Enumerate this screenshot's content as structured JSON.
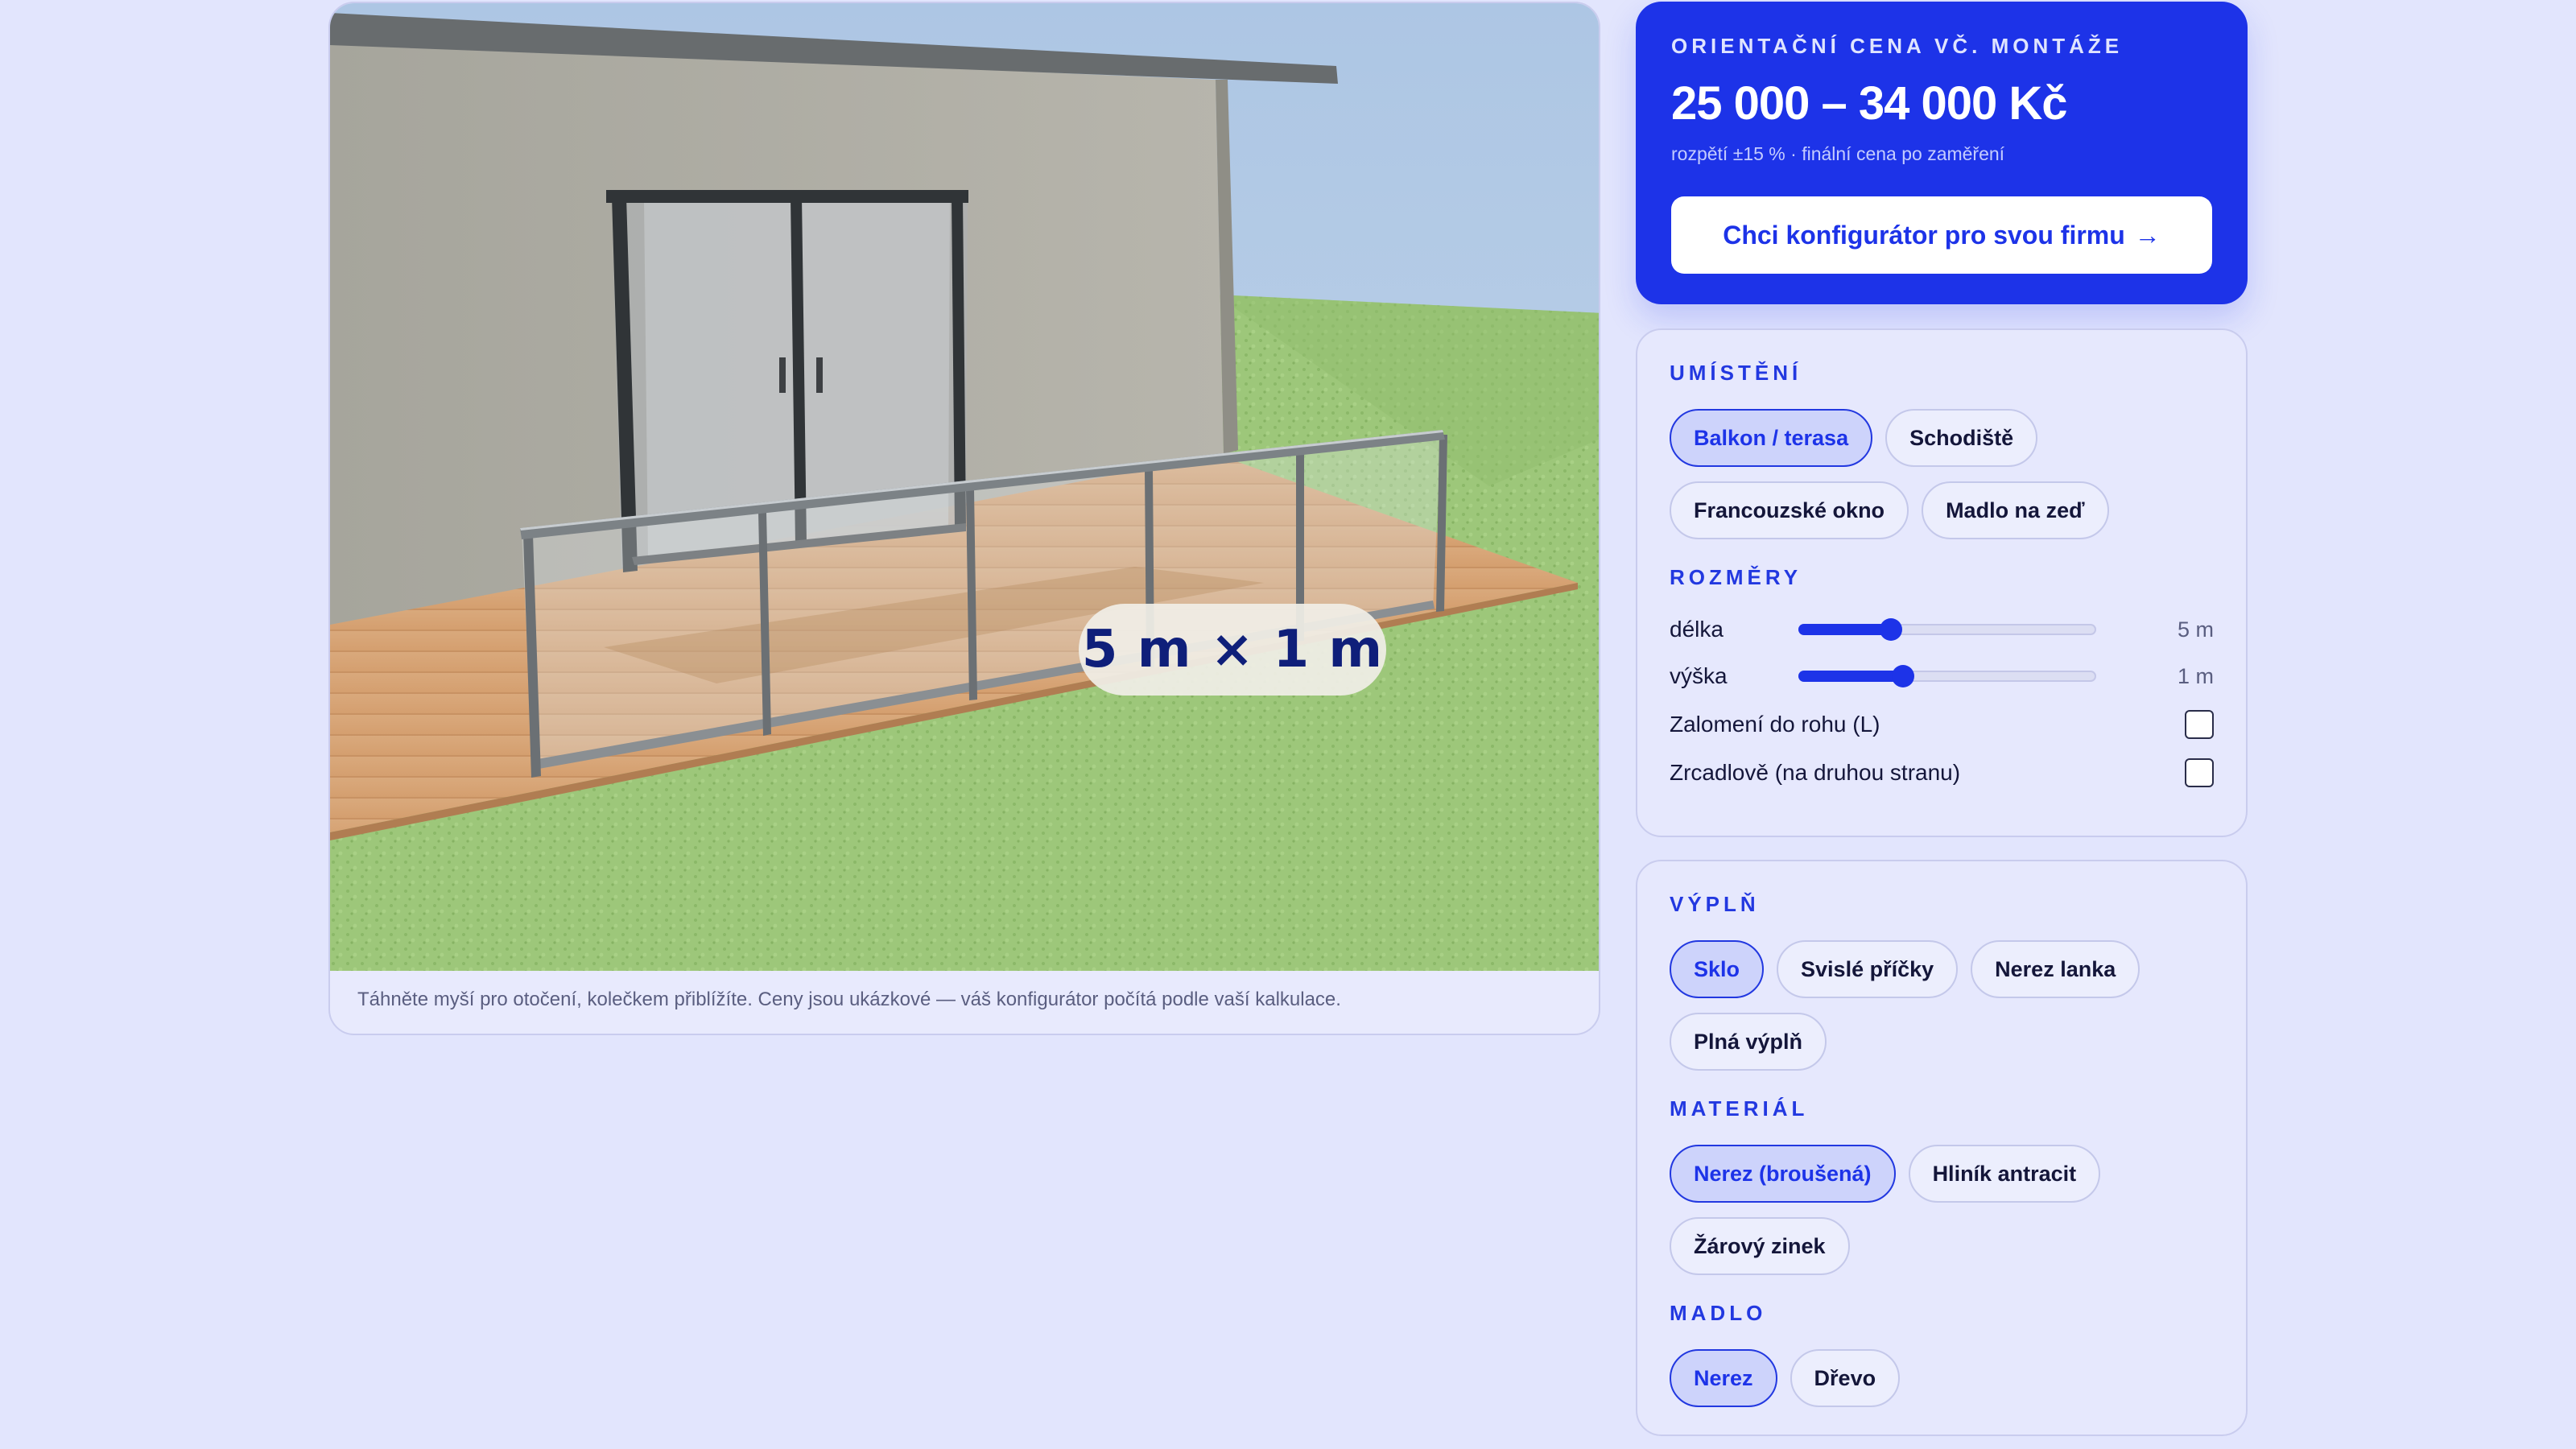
{
  "viewer": {
    "dimension_badge": "5 m × 1 m",
    "caption": "Táhněte myší pro otočení, kolečkem přiblížíte. Ceny jsou ukázkové — váš konfigurátor počítá podle vaší kalkulace."
  },
  "price": {
    "label": "ORIENTAČNÍ CENA VČ. MONTÁŽE",
    "value": "25 000 – 34 000 Kč",
    "note": "rozpětí ±15 % · finální cena po zaměření",
    "cta": "Chci konfigurátor pro svou firmu",
    "cta_arrow": "→",
    "accent_color": "#1d33e8"
  },
  "placement": {
    "title": "UMÍSTĚNÍ",
    "options": [
      "Balkon / terasa",
      "Schodiště",
      "Francouzské okno",
      "Madlo na zeď"
    ],
    "selected": "Balkon / terasa"
  },
  "dimensions": {
    "title": "ROZMĚRY",
    "length": {
      "label": "délka",
      "value": "5 m",
      "fraction": 0.31
    },
    "height": {
      "label": "výška",
      "value": "1 m",
      "fraction": 0.35
    },
    "corner": {
      "label": "Zalomení do rohu (L)",
      "checked": false
    },
    "mirror": {
      "label": "Zrcadlově (na druhou stranu)",
      "checked": false
    }
  },
  "infill": {
    "title": "VÝPLŇ",
    "options": [
      "Sklo",
      "Svislé příčky",
      "Nerez lanka",
      "Plná výplň"
    ],
    "selected": "Sklo"
  },
  "material": {
    "title": "MATERIÁL",
    "options": [
      "Nerez (broušená)",
      "Hliník antracit",
      "Žárový zinek"
    ],
    "selected": "Nerez (broušená)"
  },
  "handrail": {
    "title": "MADLO",
    "options": [
      "Nerez",
      "Dřevo"
    ],
    "selected": "Nerez"
  }
}
